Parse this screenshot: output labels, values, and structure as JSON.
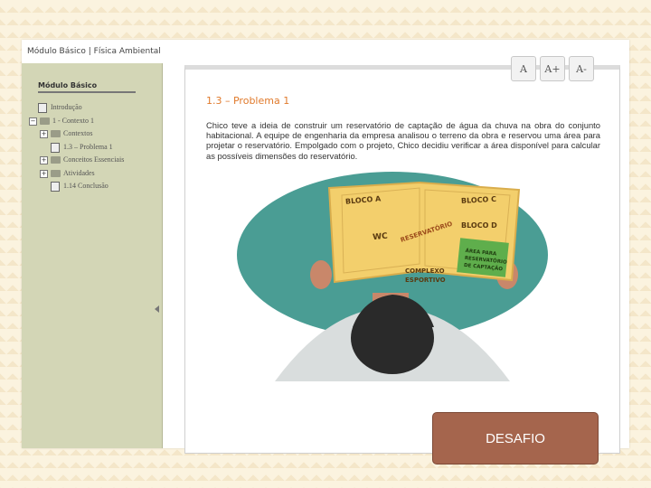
{
  "app": {
    "title": "Módulo Básico | Física Ambiental"
  },
  "sidebar": {
    "heading": "Módulo Básico",
    "tree": [
      {
        "label": "Introdução",
        "icon": "doc-icon"
      },
      {
        "label": "1 - Contexto 1",
        "icon": "folder-icon",
        "toggle": "−"
      },
      {
        "label": "Contextos",
        "icon": "folder-icon",
        "toggle": "+"
      },
      {
        "label": "1.3 – Problema 1",
        "icon": "doc-icon"
      },
      {
        "label": "Conceitos Essenciais",
        "icon": "folder-icon",
        "toggle": "+"
      },
      {
        "label": "Atividades",
        "icon": "folder-icon",
        "toggle": "+"
      },
      {
        "label": "1.14 Conclusão",
        "icon": "doc-icon"
      }
    ]
  },
  "toolbar": {
    "font_reset": "A",
    "font_increase": "A+",
    "font_decrease": "A-"
  },
  "content": {
    "section_title": "1.3 – Problema 1",
    "paragraph": "Chico teve a ideia de construir um reservatório de captação de água da chuva na obra do conjunto habitacional. A equipe de engenharia da empresa analisou o terreno da obra e reservou uma área para projetar o reservatório. Empolgado com o projeto, Chico decidiu verificar a área disponível para calcular as possíveis dimensões do reservatório.",
    "map_labels": {
      "bloco_a": "BLOCO A",
      "bloco_c": "BLOCO C",
      "bloco_d": "BLOCO D",
      "wc": "WC",
      "reservatorio": "RESERVATÓRIO",
      "complexo_1": "COMPLEXO",
      "complexo_2": "ESPORTIVO",
      "area_1": "ÁREA PARA",
      "area_2": "RESERVATÓRIO",
      "area_3": "DE CAPTAÇÃO"
    }
  },
  "action": {
    "desafio_label": "DESAFIO"
  },
  "colors": {
    "accent_title": "#e07a2c",
    "sidebar_bg": "#d3d6b6",
    "ellipse": "#4a9d94",
    "map_paper": "#f3cf6c",
    "green_area": "#5fae4c",
    "button_bg": "#a5654d"
  }
}
